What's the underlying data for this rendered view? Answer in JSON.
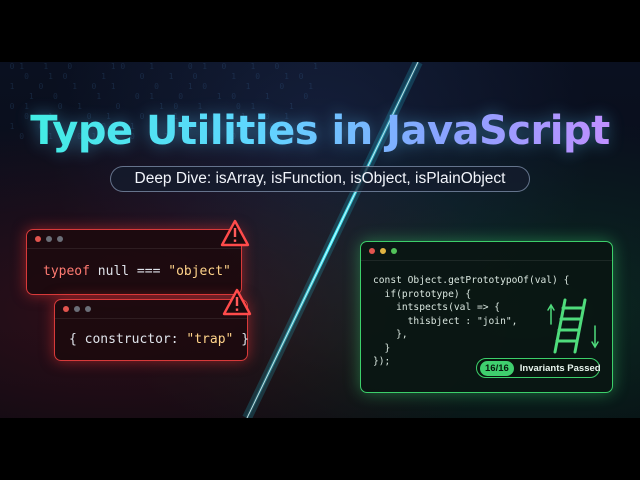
{
  "title": "Type Utilities in JavaScript",
  "subtitle": "Deep Dive: isArray, isFunction, isObject, isPlainObject",
  "snippet_typeof": {
    "kw": "typeof",
    "rest": " null === ",
    "str": "\"object\""
  },
  "snippet_constructor": {
    "pre": "{ constructor: ",
    "str": "\"trap\"",
    "post": " }"
  },
  "code_window": {
    "lines": [
      "const Object.getPrototypoOf(val) {",
      "  if(prototype) {",
      "    intspects(val => {",
      "      thisbject : \"join\",",
      "    },",
      "  }",
      "});"
    ]
  },
  "badge": {
    "count": "16/16",
    "label": "Invariants Passed"
  },
  "colors": {
    "danger": "#d83a3a",
    "success": "#3ccf6a",
    "title_start": "#3ff0e0",
    "title_end": "#c98cff"
  },
  "icons": [
    "warning-icon",
    "warning-icon",
    "ladder-icon",
    "window-dots"
  ]
}
